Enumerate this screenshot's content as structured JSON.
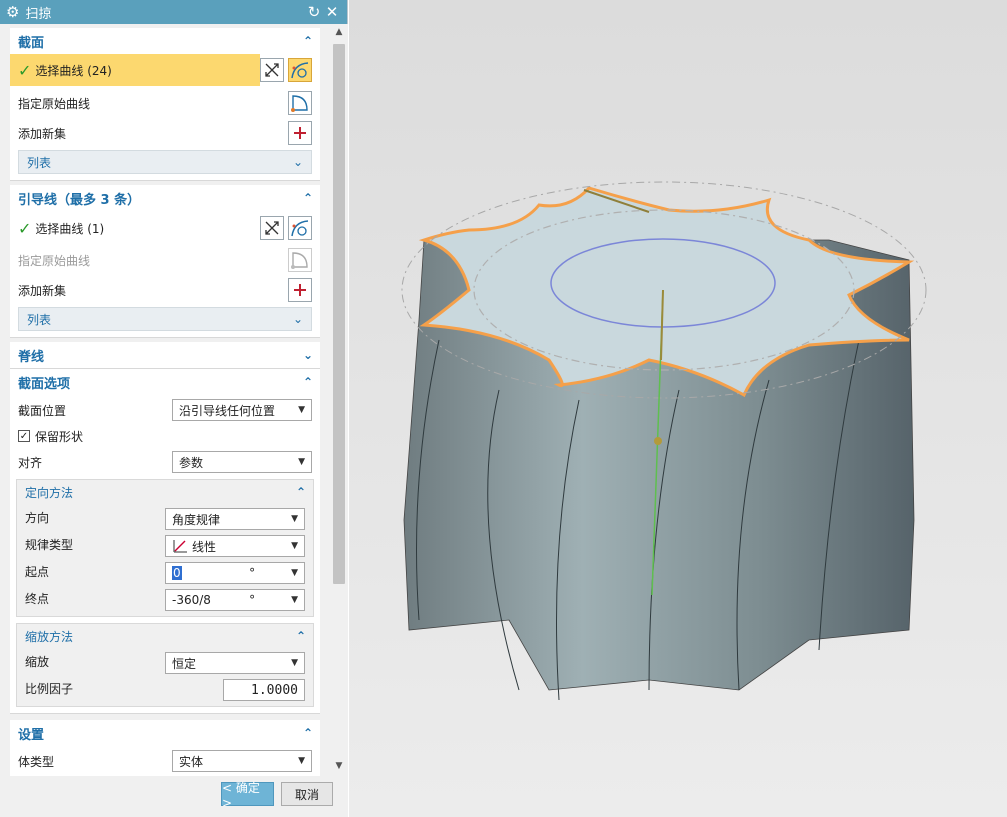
{
  "dialog": {
    "title": "扫掠",
    "sections": {
      "section": {
        "title": "截面",
        "select_curve": "选择曲线 (24)",
        "specify_origin": "指定原始曲线",
        "add_new_set": "添加新集",
        "list": "列表"
      },
      "guide": {
        "title": "引导线（最多 3 条）",
        "select_curve": "选择曲线 (1)",
        "specify_origin": "指定原始曲线",
        "add_new_set": "添加新集",
        "list": "列表"
      },
      "spine": {
        "title": "脊线"
      },
      "section_options": {
        "title": "截面选项",
        "position_label": "截面位置",
        "position_value": "沿引导线任何位置",
        "preserve_shape": "保留形状",
        "align_label": "对齐",
        "align_value": "参数",
        "orientation": {
          "title": "定向方法",
          "direction_label": "方向",
          "direction_value": "角度规律",
          "law_type_label": "规律类型",
          "law_type_value": "线性",
          "start_label": "起点",
          "start_value": "0",
          "start_unit": "°",
          "end_label": "终点",
          "end_value": "-360/8",
          "end_unit": "°"
        },
        "scaling": {
          "title": "缩放方法",
          "scale_label": "缩放",
          "scale_value": "恒定",
          "factor_label": "比例因子",
          "factor_value": "1.0000"
        }
      },
      "settings": {
        "title": "设置",
        "body_type_label": "体类型",
        "body_type_value": "实体"
      }
    },
    "buttons": {
      "ok": "< 确定 >",
      "cancel": "取消"
    }
  },
  "colors": {
    "accent": "#1f6fa8",
    "titlebar": "#5aa0bc",
    "highlight": "#fcd86f",
    "profile": "#f5a04a"
  },
  "icons": [
    "gear-icon",
    "reset-icon",
    "close-icon",
    "check-icon",
    "swap-icon",
    "curve-select-icon",
    "origin-curve-icon",
    "add-set-icon",
    "chevron-up-icon",
    "chevron-down-icon",
    "law-linear-icon"
  ]
}
